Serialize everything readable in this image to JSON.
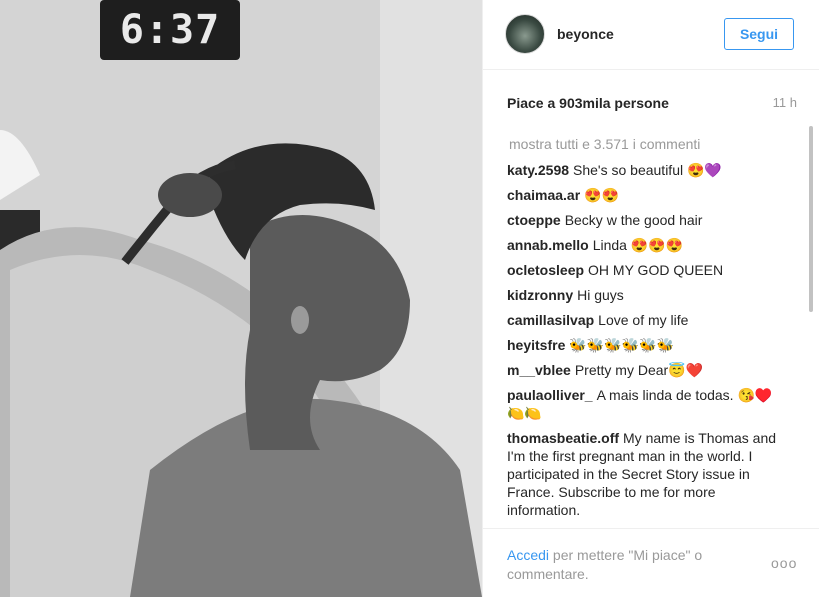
{
  "post": {
    "username": "beyonce",
    "follow_label": "Segui",
    "likes": "Piace a 903mila persone",
    "time": "11 h",
    "clock": "6:37",
    "show_all": "mostra tutti e 3.571 i commenti",
    "comments": [
      {
        "user": "katy.2598",
        "text": "She's so beautiful 😍💜"
      },
      {
        "user": "chaimaa.ar",
        "text": "😍😍"
      },
      {
        "user": "ctoeppe",
        "text": "Becky w the good hair"
      },
      {
        "user": "annab.mello",
        "text": "Linda 😍😍😍"
      },
      {
        "user": "ocletosleep",
        "text": "OH MY GOD QUEEN"
      },
      {
        "user": "kidzronny",
        "text": "Hi guys"
      },
      {
        "user": "camillasilvap",
        "text": "Love of my life"
      },
      {
        "user": "heyitsfre",
        "text": "🐝🐝🐝🐝🐝🐝"
      },
      {
        "user": "m__vblee",
        "text": "Pretty my Dear😇❤️"
      },
      {
        "user": "paulaolliver_",
        "text": "A mais linda de todas. 😘♥️🍋🍋"
      },
      {
        "user": "thomasbeatie.off",
        "text": "My name is Thomas and I'm the first pregnant man in the world. I participated in the Secret Story issue in France. Subscribe to me for more information."
      }
    ],
    "footer": {
      "login_link": "Accedi",
      "login_rest": "per mettere \"Mi piace\" o commentare.",
      "more": "ooo"
    }
  }
}
